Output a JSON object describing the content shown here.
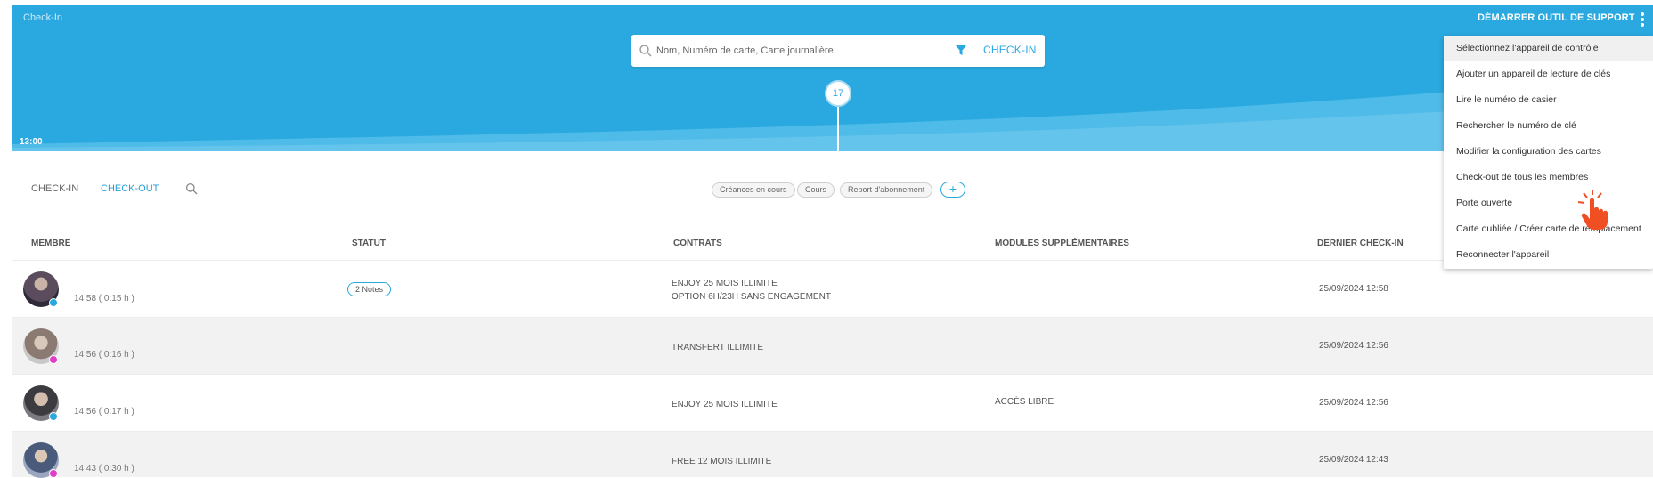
{
  "header": {
    "app_title": "Check-In",
    "support_label": "DÉMARRER OUTIL DE SUPPORT",
    "time_label": "13:00",
    "checkin_count": "17"
  },
  "search": {
    "placeholder": "Nom, Numéro de carte, Carte journalière",
    "checkin_label": "CHECK-IN"
  },
  "tabs": {
    "checkin_label": "CHECK-IN",
    "checkout_label": "CHECK-OUT"
  },
  "chips": {
    "creances": "Créances en cours",
    "cours": "Cours",
    "report": "Report d'abonnement",
    "add": "+"
  },
  "table": {
    "columns": [
      "MEMBRE",
      "STATUT",
      "CONTRATS",
      "MODULES SUPPLÉMENTAIRES",
      "DERNIER CHECK-IN"
    ],
    "rows": [
      {
        "time": "14:58 ( 0:15 h )",
        "status": "2 Notes",
        "contracts": [
          "ENJOY 25 MOIS ILLIMITE",
          "OPTION 6H/23H SANS ENGAGEMENT"
        ],
        "module": "",
        "last": "25/09/2024 12:58",
        "dot_color": "#2aa9e0"
      },
      {
        "time": "14:56 ( 0:16 h )",
        "status": "",
        "contracts": [
          "TRANSFERT ILLIMITE"
        ],
        "module": "",
        "last": "25/09/2024 12:56",
        "dot_color": "#e040c8"
      },
      {
        "time": "14:56 ( 0:17 h )",
        "status": "",
        "contracts": [
          "ENJOY 25 MOIS ILLIMITE"
        ],
        "module": "ACCÈS LIBRE",
        "last": "25/09/2024 12:56",
        "dot_color": "#2aa9e0"
      },
      {
        "time": "14:43 ( 0:30 h )",
        "status": "",
        "contracts": [
          "FREE 12 MOIS ILLIMITE"
        ],
        "module": "",
        "last": "25/09/2024 12:43",
        "dot_color": "#e040c8"
      }
    ]
  },
  "menu": {
    "items": [
      "Sélectionnez l'appareil de contrôle",
      "Ajouter un appareil de lecture de clés",
      "Lire le numéro de casier",
      "Rechercher le numéro de clé",
      "Modifier la configuration des cartes",
      "Check-out de tous les membres",
      "Porte ouverte",
      "Carte oubliée / Créer carte de remplacement",
      "Reconnecter l'appareil"
    ]
  },
  "colors": {
    "primary": "#2aa9e0",
    "cursor": "#f04e23"
  }
}
